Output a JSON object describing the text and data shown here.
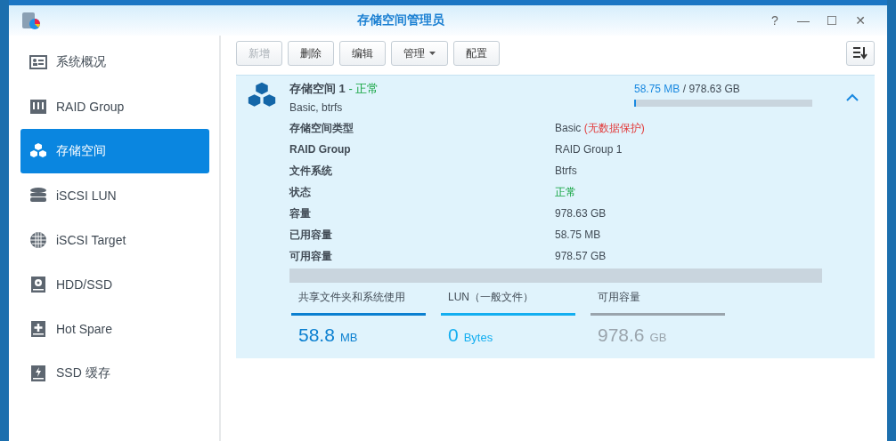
{
  "window": {
    "title": "存储空间管理员",
    "controls": [
      "?",
      "—",
      "☐",
      "✕"
    ]
  },
  "sidebar": {
    "items": [
      {
        "label": "系统概况",
        "selected": false
      },
      {
        "label": "RAID Group",
        "selected": false
      },
      {
        "label": "存储空间",
        "selected": true
      },
      {
        "label": "iSCSI LUN",
        "selected": false
      },
      {
        "label": "iSCSI Target",
        "selected": false
      },
      {
        "label": "HDD/SSD",
        "selected": false
      },
      {
        "label": "Hot Spare",
        "selected": false
      },
      {
        "label": "SSD 缓存",
        "selected": false
      }
    ]
  },
  "toolbar": {
    "buttons": [
      {
        "label": "新增",
        "disabled": true,
        "kind": "plain"
      },
      {
        "label": "删除",
        "disabled": false,
        "kind": "plain"
      },
      {
        "label": "编辑",
        "disabled": false,
        "kind": "plain"
      },
      {
        "label": "管理",
        "disabled": false,
        "kind": "dropdown"
      },
      {
        "label": "配置",
        "disabled": false,
        "kind": "plain"
      }
    ]
  },
  "volume": {
    "name": "存储空间 1",
    "separator": "-",
    "status": "正常",
    "subtitle": "Basic, btrfs",
    "used": "58.75 MB",
    "slash": "/",
    "total": "978.63 GB",
    "level": 0.0001,
    "expanded": true,
    "details": [
      {
        "label": "存储空间类型",
        "value": "Basic",
        "note": "(无数据保护)",
        "kind": "plain"
      },
      {
        "label": "RAID Group",
        "value": "RAID Group 1",
        "kind": "plain"
      },
      {
        "label": "文件系统",
        "value": "Btrfs",
        "kind": "plain"
      },
      {
        "label": "状态",
        "value": "正常",
        "kind": "status"
      },
      {
        "label": "容量",
        "value": "978.63 GB",
        "kind": "plain"
      },
      {
        "label": "已用容量",
        "value": "58.75 MB",
        "kind": "plain"
      },
      {
        "label": "可用容量",
        "value": "978.57 GB",
        "kind": "plain"
      }
    ],
    "legend": [
      {
        "label": "共享文件夹和系统使用",
        "number": "58.8",
        "unit": "MB",
        "color": "#0a7fd0"
      },
      {
        "label": "LUN（一般文件）",
        "number": "0",
        "unit": "Bytes",
        "color": "#13aef0"
      },
      {
        "label": "可用容量",
        "number": "978.6",
        "unit": "GB",
        "color": "#9aa4ac"
      }
    ]
  }
}
